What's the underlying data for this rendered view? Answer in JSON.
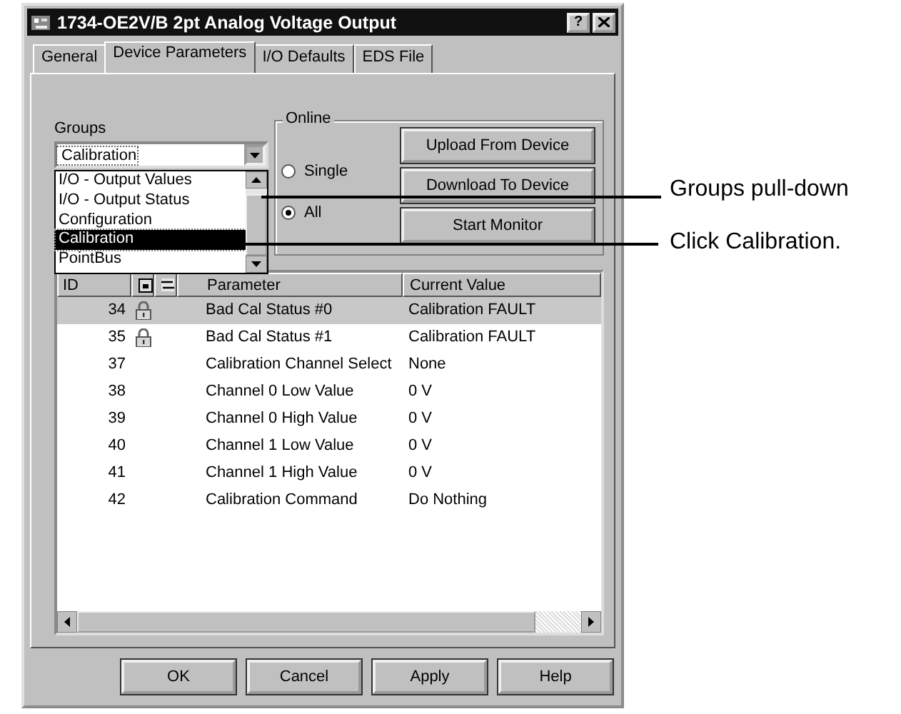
{
  "window": {
    "title": "1734-OE2V/B 2pt Analog Voltage Output",
    "help_button": "?"
  },
  "tabs": [
    {
      "label": "General",
      "selected": false
    },
    {
      "label": "Device Parameters",
      "selected": true
    },
    {
      "label": "I/O Defaults",
      "selected": false
    },
    {
      "label": "EDS File",
      "selected": false
    }
  ],
  "groups": {
    "label": "Groups",
    "value": "Calibration",
    "expanded": true,
    "options": [
      {
        "label": "I/O - Output Values",
        "selected": false
      },
      {
        "label": "I/O - Output Status",
        "selected": false
      },
      {
        "label": "Configuration",
        "selected": false
      },
      {
        "label": "Calibration",
        "selected": true
      },
      {
        "label": "PointBus",
        "selected": false
      }
    ]
  },
  "online": {
    "title": "Online",
    "radios": [
      {
        "label": "Single",
        "selected": false
      },
      {
        "label": "All",
        "selected": true
      }
    ],
    "buttons": [
      "Upload From Device",
      "Download To Device",
      "Start Monitor"
    ]
  },
  "table": {
    "columns": [
      "ID",
      "Parameter",
      "Current Value"
    ],
    "rows": [
      {
        "id": "34",
        "locked": true,
        "selected": true,
        "parameter": "Bad Cal Status #0",
        "value": "Calibration FAULT"
      },
      {
        "id": "35",
        "locked": true,
        "selected": false,
        "parameter": "Bad Cal Status #1",
        "value": "Calibration FAULT"
      },
      {
        "id": "37",
        "locked": false,
        "selected": false,
        "parameter": "Calibration Channel Select",
        "value": "None"
      },
      {
        "id": "38",
        "locked": false,
        "selected": false,
        "parameter": "Channel 0 Low Value",
        "value": "0 V"
      },
      {
        "id": "39",
        "locked": false,
        "selected": false,
        "parameter": "Channel 0 High Value",
        "value": "0 V"
      },
      {
        "id": "40",
        "locked": false,
        "selected": false,
        "parameter": "Channel 1 Low Value",
        "value": "0 V"
      },
      {
        "id": "41",
        "locked": false,
        "selected": false,
        "parameter": "Channel 1 High Value",
        "value": "0 V"
      },
      {
        "id": "42",
        "locked": false,
        "selected": false,
        "parameter": "Calibration Command",
        "value": "Do Nothing"
      }
    ]
  },
  "buttons": [
    "OK",
    "Cancel",
    "Apply",
    "Help"
  ],
  "callouts": [
    "Groups pull-down",
    "Click Calibration."
  ]
}
